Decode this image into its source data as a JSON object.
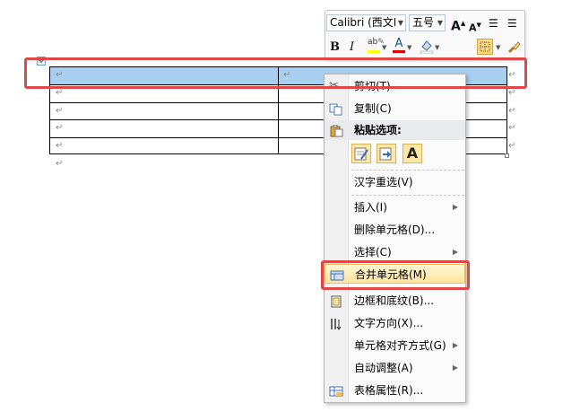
{
  "mini_toolbar": {
    "font_name": "Calibri (西文I",
    "font_size": "五号",
    "bold": "B",
    "italic": "I",
    "font_color_letter": "A",
    "grow_font": "A",
    "shrink_font": "A"
  },
  "context_menu": {
    "items": [
      {
        "label": "剪切(T)",
        "icon": "scissors-icon"
      },
      {
        "label": "复制(C)",
        "icon": "copy-icon"
      },
      {
        "label": "粘贴选项:",
        "icon": "paste-icon"
      },
      {
        "label": "汉字重选(V)"
      },
      {
        "label": "插入(I)"
      },
      {
        "label": "删除单元格(D)..."
      },
      {
        "label": "选择(C)"
      },
      {
        "label": "合并单元格(M)",
        "icon": "merge-cells-icon"
      },
      {
        "label": "边框和底纹(B)...",
        "icon": "borders-icon"
      },
      {
        "label": "文字方向(X)...",
        "icon": "text-direction-icon"
      },
      {
        "label": "单元格对齐方式(G)"
      },
      {
        "label": "自动调整(A)"
      },
      {
        "label": "表格属性(R)...",
        "icon": "table-properties-icon"
      }
    ],
    "paste_option_text_only": "A"
  },
  "colors": {
    "selection": "#a8cef0",
    "highlight_frame": "#e04848",
    "menu_hover": "#ffe59b"
  }
}
